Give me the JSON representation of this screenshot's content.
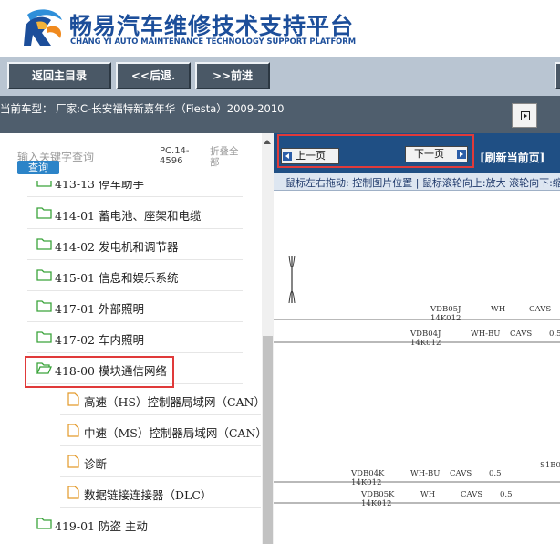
{
  "header": {
    "title": "畅易汽车维修技术支持平台",
    "subtitle": "CHANG YI AUTO MAINTENANCE TECHNOLOGY SUPPORT PLATFORM"
  },
  "toolbar": {
    "home_label": "返回主目录",
    "back_label": "<<后退.",
    "forward_label": ">>前进",
    "extra_label": "▯"
  },
  "vehicle": {
    "info": "当前车型：  厂家:C-长安福特新嘉年华（Fiesta）2009-2010"
  },
  "search": {
    "placeholder": "输入关键字查询",
    "button_label": "查询",
    "pc_code": "PC.14-4596",
    "collapse_label": "折叠全部"
  },
  "tree": {
    "items": [
      {
        "label": "413-13 停车助手",
        "type": "folder"
      },
      {
        "label": "414-01 蓄电池、座架和电缆",
        "type": "folder"
      },
      {
        "label": "414-02 发电机和调节器",
        "type": "folder"
      },
      {
        "label": "415-01 信息和娱乐系统",
        "type": "folder"
      },
      {
        "label": "417-01 外部照明",
        "type": "folder"
      },
      {
        "label": "417-02 车内照明",
        "type": "folder"
      },
      {
        "label": "418-00 模块通信网络",
        "type": "folder-open"
      },
      {
        "label": "高速（HS）控制器局域网（CAN）",
        "type": "file"
      },
      {
        "label": "中速（MS）控制器局域网（CAN）",
        "type": "file"
      },
      {
        "label": "诊断",
        "type": "file"
      },
      {
        "label": "数据链接连接器（DLC）",
        "type": "file"
      },
      {
        "label": "419-01 防盗 主动",
        "type": "folder"
      }
    ]
  },
  "viewer": {
    "prev_label": "上一页",
    "next_label": "下一页",
    "refresh_label": "[刷新当前页]",
    "hint": "鼠标左右拖动: 控制图片位置 | 鼠标滚轮向上:放大  滚轮向下:缩小"
  },
  "wiring": {
    "w1": [
      "VDB05J",
      "14K012",
      "WH",
      "CAVS"
    ],
    "w2": [
      "VDB04J",
      "14K012",
      "WH-BU",
      "CAVS",
      "0.5"
    ],
    "w3": [
      "VDB04K",
      "14K012",
      "WH-BU",
      "CAVS",
      "0.5"
    ],
    "w4": [
      "VDB05K",
      "14K012",
      "WH",
      "CAVS",
      "0.5"
    ],
    "side": "S1B0"
  },
  "colors": {
    "brand_blue": "#1c4e9a",
    "toolbar_bg": "#b9c5d2",
    "info_bar_bg": "#4f5e6d",
    "nav_bar_bg": "#1f4f84",
    "highlight_red": "#e03a3a",
    "folder_green": "#3aa33a",
    "file_orange": "#e39a2a"
  }
}
